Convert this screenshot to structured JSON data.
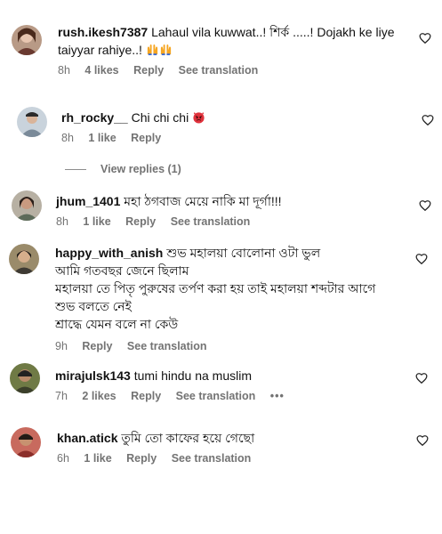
{
  "comments": [
    {
      "username": "rush.ikesh7387",
      "text_lines": [
        "Lahaul vila kuwwat..! শির্ক .....! Dojakh ke liye",
        "taiyyar rahiye..!"
      ],
      "time": "8h",
      "likes": "4 likes",
      "reply": "Reply",
      "see_translation": "See translation"
    },
    {
      "username": "rh_rocky__",
      "text_lines": [
        "Chi chi chi"
      ],
      "time": "8h",
      "likes": "1 like",
      "reply": "Reply"
    },
    {
      "username": "jhum_1401",
      "text_lines": [
        "মহা ঠগবাজ মেয়ে নাকি মা দূর্গা!!!"
      ],
      "time": "8h",
      "likes": "1 like",
      "reply": "Reply",
      "see_translation": "See translation"
    },
    {
      "username": "happy_with_anish",
      "text_lines": [
        "শুভ মহালয়া বোলোনা ওটা ভুল",
        "আমি গতবছর জেনে ছিলাম",
        "মহালয়া তে পিতৃ পুরুষের তর্পণ করা হয় তাই মহালয়া শব্দটার আগে",
        "শুভ বলতে নেই",
        "শ্রাদ্ধে যেমন বলে না কেউ"
      ],
      "time": "9h",
      "reply": "Reply",
      "see_translation": "See translation"
    },
    {
      "username": "mirajulsk143",
      "text_lines": [
        "tumi hindu na muslim"
      ],
      "time": "7h",
      "likes": "2 likes",
      "reply": "Reply",
      "see_translation": "See translation",
      "more": "•••"
    },
    {
      "username": "khan.atick",
      "text_lines": [
        "তুমি তো কাফের হয়ে গেছো"
      ],
      "time": "6h",
      "likes": "1 like",
      "reply": "Reply",
      "see_translation": "See translation"
    }
  ],
  "view_replies": "View replies (1)",
  "icons": {
    "like": "heart-outline-icon",
    "hands": "raised-hands-emoji",
    "angry": "angry-devil-emoji"
  },
  "colors": {
    "text": "#111111",
    "meta": "#737373",
    "emoji_hands": "#f5a623",
    "emoji_devil": "#e0323c"
  }
}
